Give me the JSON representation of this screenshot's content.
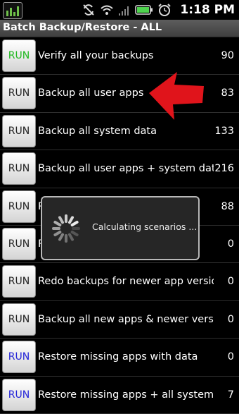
{
  "status_bar": {
    "time": "1:18 PM",
    "icons": [
      "app-icon",
      "sync-off-icon",
      "wifi-icon",
      "signal-icon",
      "battery-icon",
      "alarm-icon"
    ]
  },
  "title": "Batch Backup/Restore - ALL",
  "run_colors": {
    "green": "#1fb81f",
    "black": "#222222",
    "blue": "#2424d8"
  },
  "rows": [
    {
      "button": "RUN",
      "button_color": "green",
      "label": "Verify all your backups",
      "count": "90"
    },
    {
      "button": "RUN",
      "button_color": "black",
      "label": "Backup all user apps",
      "count": "83"
    },
    {
      "button": "RUN",
      "button_color": "black",
      "label": "Backup all system data",
      "count": "133"
    },
    {
      "button": "RUN",
      "button_color": "black",
      "label": "Backup all user apps + system data",
      "count": "216"
    },
    {
      "button": "RUN",
      "button_color": "black",
      "label": "R",
      "count": "88"
    },
    {
      "button": "RUN",
      "button_color": "black",
      "label": "R",
      "count": "0"
    },
    {
      "button": "RUN",
      "button_color": "black",
      "label": "Redo backups for newer app versions",
      "count": "0"
    },
    {
      "button": "RUN",
      "button_color": "black",
      "label": "Backup all new apps & newer versions",
      "count": "0"
    },
    {
      "button": "RUN",
      "button_color": "blue",
      "label": "Restore missing apps with data",
      "count": "0"
    },
    {
      "button": "RUN",
      "button_color": "blue",
      "label": "Restore missing apps + all system data",
      "count": "7"
    }
  ],
  "dialog": {
    "message": "Calculating scenarios ..."
  },
  "annotation_color": "#e0141b"
}
